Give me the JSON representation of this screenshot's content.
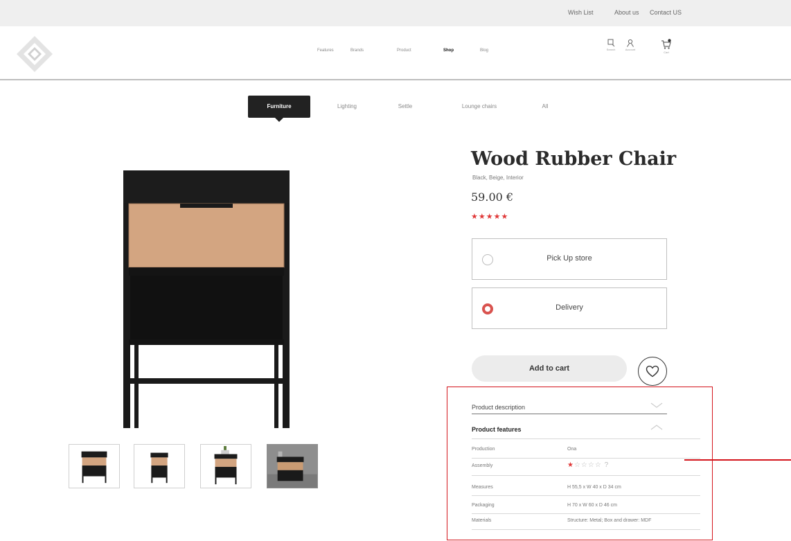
{
  "top_links": [
    "Wish List",
    "About us",
    "Contact US"
  ],
  "nav": {
    "items": [
      "Features",
      "Brands",
      "Product",
      "Shop",
      "Blog"
    ],
    "active": "Shop"
  },
  "header_icons": [
    {
      "icon": "search-icon",
      "label": "Search"
    },
    {
      "icon": "user-icon",
      "label": "Account"
    },
    {
      "icon": "cart-icon",
      "label": "Cart"
    }
  ],
  "categories": [
    "Furniture",
    "Lighting",
    "Settle",
    "Lounge chairs",
    "All"
  ],
  "active_category": "Furniture",
  "product": {
    "title": "Wood Rubber Chair",
    "subtitle": "Black, Beige, Interior",
    "price": "59.00 €",
    "rating_stars": "★★★★★",
    "rating_value": 5
  },
  "delivery_options": [
    {
      "label": "Pick Up store",
      "selected": false
    },
    {
      "label": "Delivery",
      "selected": true
    }
  ],
  "add_to_cart": "Add to cart",
  "accordion": {
    "description": "Product description",
    "features": "Product features"
  },
  "features": [
    {
      "key": "Production",
      "value": "Ona"
    },
    {
      "key": "Assembly",
      "value": "",
      "rating": 1,
      "rating_max": 5,
      "rating_suffix": "?"
    },
    {
      "key": "Measures",
      "value": "H 55,5 x W 40 x D 34 cm"
    },
    {
      "key": "Packaging",
      "value": "H 70 x W 60 x D 46 cm"
    },
    {
      "key": "Materials",
      "value": "Structure: Metal; Box and drawer: MDF"
    }
  ],
  "colors": {
    "accent": "#e03838",
    "highlight": "#d4141b",
    "dark": "#222222",
    "wood": "#d4a882"
  }
}
